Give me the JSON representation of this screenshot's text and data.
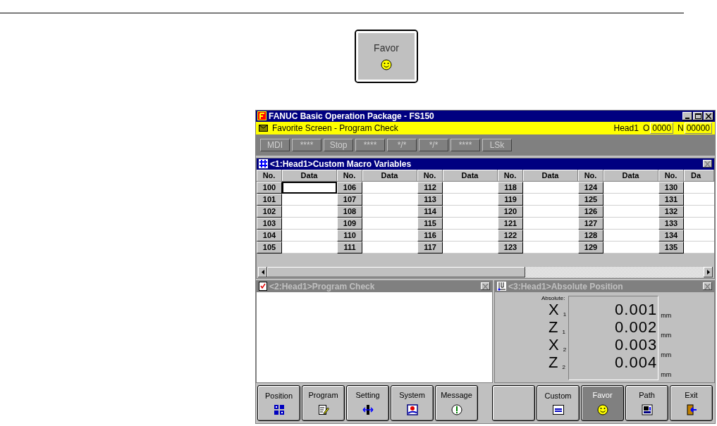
{
  "favor_button": {
    "label": "Favor",
    "kind": "smiley"
  },
  "window": {
    "title": "FANUC Basic Operation Package - FS150"
  },
  "screen_bar": {
    "title": "Favorite Screen - Program Check",
    "head": "Head1",
    "o_label": "O",
    "o_value": "0000",
    "n_label": "N",
    "n_value": "00000"
  },
  "status": [
    "MDI",
    "****",
    "Stop",
    "****",
    "*/*",
    "*/*",
    "****",
    "LSk"
  ],
  "macro_panel": {
    "title": "<1:Head1>Custom Macro Variables",
    "active": true,
    "groups": [
      {
        "no_header": "No.",
        "data_header": "Data",
        "cells": [
          {
            "no": "100",
            "selected": true
          },
          {
            "no": "101",
            "selected": false
          },
          {
            "no": "102",
            "selected": false
          },
          {
            "no": "103",
            "selected": false
          },
          {
            "no": "104",
            "selected": false
          },
          {
            "no": "105",
            "selected": false
          }
        ]
      },
      {
        "no_header": "No.",
        "data_header": "Data",
        "cells": [
          {
            "no": "106",
            "selected": false
          },
          {
            "no": "107",
            "selected": false
          },
          {
            "no": "108",
            "selected": false
          },
          {
            "no": "109",
            "selected": false
          },
          {
            "no": "110",
            "selected": false
          },
          {
            "no": "111",
            "selected": false
          }
        ]
      },
      {
        "no_header": "No.",
        "data_header": "Data",
        "cells": [
          {
            "no": "112",
            "selected": false
          },
          {
            "no": "113",
            "selected": false
          },
          {
            "no": "114",
            "selected": false
          },
          {
            "no": "115",
            "selected": false
          },
          {
            "no": "116",
            "selected": false
          },
          {
            "no": "117",
            "selected": false
          }
        ]
      },
      {
        "no_header": "No.",
        "data_header": "Data",
        "cells": [
          {
            "no": "118",
            "selected": false
          },
          {
            "no": "119",
            "selected": false
          },
          {
            "no": "120",
            "selected": false
          },
          {
            "no": "121",
            "selected": false
          },
          {
            "no": "122",
            "selected": false
          },
          {
            "no": "123",
            "selected": false
          }
        ]
      },
      {
        "no_header": "No.",
        "data_header": "Data",
        "cells": [
          {
            "no": "124",
            "selected": false
          },
          {
            "no": "125",
            "selected": false
          },
          {
            "no": "126",
            "selected": false
          },
          {
            "no": "127",
            "selected": false
          },
          {
            "no": "128",
            "selected": false
          },
          {
            "no": "129",
            "selected": false
          }
        ]
      },
      {
        "no_header": "No.",
        "data_header": "Da",
        "cells": [
          {
            "no": "130",
            "selected": false
          },
          {
            "no": "131",
            "selected": false
          },
          {
            "no": "132",
            "selected": false
          },
          {
            "no": "133",
            "selected": false
          },
          {
            "no": "134",
            "selected": false
          },
          {
            "no": "135",
            "selected": false
          }
        ]
      }
    ]
  },
  "check_panel": {
    "title": "<2:Head1>Program Check",
    "active": false
  },
  "position_panel": {
    "title": "<3:Head1>Absolute Position",
    "active": false,
    "label": "Absolute:",
    "axes": [
      {
        "axis": "X",
        "index": "1",
        "value": "0.001",
        "unit": "mm"
      },
      {
        "axis": "Z",
        "index": "1",
        "value": "0.002",
        "unit": "mm"
      },
      {
        "axis": "X",
        "index": "2",
        "value": "0.003",
        "unit": "mm"
      },
      {
        "axis": "Z",
        "index": "2",
        "value": "0.004",
        "unit": "mm"
      }
    ]
  },
  "soft_keys": [
    {
      "label": "Position",
      "kind": "grid",
      "selected": false
    },
    {
      "label": "Program",
      "kind": "page",
      "selected": false
    },
    {
      "label": "Setting",
      "kind": "setting",
      "selected": false
    },
    {
      "label": "System",
      "kind": "system",
      "selected": false
    },
    {
      "label": "Message",
      "kind": "message",
      "selected": false
    },
    {
      "kind": "blank",
      "selected": false
    },
    {
      "label": "Custom",
      "kind": "custom",
      "selected": false
    },
    {
      "label": "Favor",
      "kind": "smiley",
      "selected": true
    },
    {
      "label": "Path",
      "kind": "path",
      "selected": false
    },
    {
      "label": "Exit",
      "kind": "exit",
      "selected": false
    }
  ]
}
